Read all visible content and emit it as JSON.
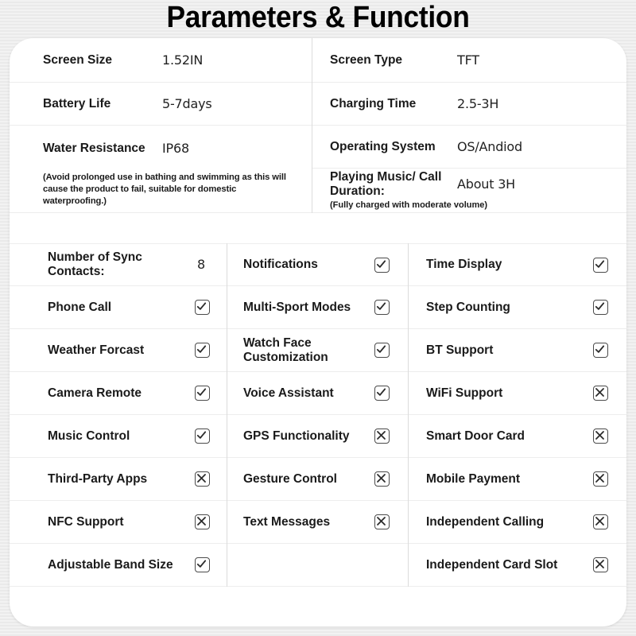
{
  "title": "Parameters & Function",
  "specs": {
    "left": [
      {
        "label": "Screen Size",
        "value": "1.52IN"
      },
      {
        "label": "Battery Life",
        "value": "5-7days"
      }
    ],
    "water_resistance": {
      "label": "Water Resistance",
      "value": "IP68",
      "note": "(Avoid prolonged use in bathing and swimming as this will cause the product to fail, suitable for domestic waterproofing.)"
    },
    "right": [
      {
        "label": "Screen Type",
        "value": "TFT"
      },
      {
        "label": "Charging Time",
        "value": "2.5-3H"
      },
      {
        "label": "Operating System",
        "value": "OS/Andiod"
      }
    ],
    "playing_music": {
      "label": "Playing Music/ Call Duration:",
      "value": "About 3H",
      "note": "(Fully charged with moderate volume)"
    }
  },
  "features": {
    "col1": [
      {
        "label": "Number of Sync Contacts:",
        "mark": "number",
        "value": "8"
      },
      {
        "label": "Phone Call",
        "mark": "check"
      },
      {
        "label": "Weather Forcast",
        "mark": "check"
      },
      {
        "label": "Camera Remote",
        "mark": "check"
      },
      {
        "label": "Music Control",
        "mark": "check"
      },
      {
        "label": "Third-Party Apps",
        "mark": "cross"
      },
      {
        "label": "NFC Support",
        "mark": "cross"
      },
      {
        "label": "Adjustable Band Size",
        "mark": "check"
      }
    ],
    "col2": [
      {
        "label": "Notifications",
        "mark": "check"
      },
      {
        "label": "Multi-Sport Modes",
        "mark": "check"
      },
      {
        "label": "Watch Face Customization",
        "mark": "check"
      },
      {
        "label": "Voice Assistant",
        "mark": "check"
      },
      {
        "label": "GPS Functionality",
        "mark": "cross"
      },
      {
        "label": "Gesture Control",
        "mark": "cross"
      },
      {
        "label": "Text Messages",
        "mark": "cross"
      },
      {
        "label": "",
        "mark": "none"
      }
    ],
    "col3": [
      {
        "label": "Time Display",
        "mark": "check"
      },
      {
        "label": "Step Counting",
        "mark": "check"
      },
      {
        "label": "BT Support",
        "mark": "check"
      },
      {
        "label": "WiFi Support",
        "mark": "cross"
      },
      {
        "label": "Smart Door Card",
        "mark": "cross"
      },
      {
        "label": "Mobile Payment",
        "mark": "cross"
      },
      {
        "label": "Independent Calling",
        "mark": "cross"
      },
      {
        "label": "Independent Card Slot",
        "mark": "cross"
      }
    ]
  },
  "colors": {
    "page_background": "#efefef",
    "card_background": "#ffffff",
    "text": "#1a1a1a",
    "divider": "#ededed",
    "column_divider": "#dcdcdc",
    "mark_border": "#4a4a4a"
  }
}
